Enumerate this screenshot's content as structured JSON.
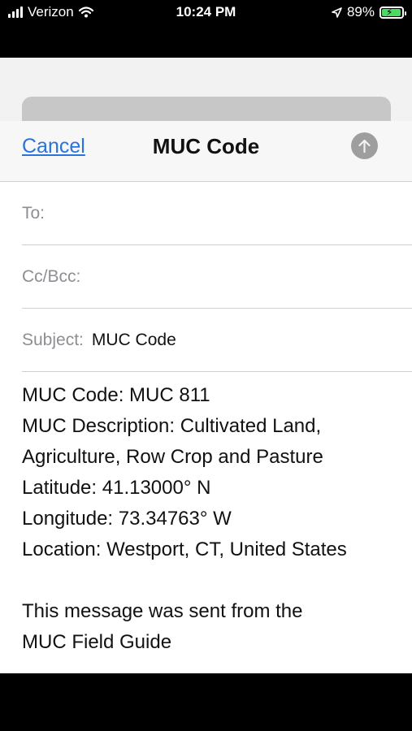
{
  "status_bar": {
    "carrier": "Verizon",
    "time": "10:24 PM",
    "battery_percent": "89%"
  },
  "nav": {
    "cancel_label": "Cancel",
    "title": "MUC Code",
    "send_icon": "arrow-up-icon"
  },
  "fields": {
    "to_label": "To:",
    "cc_label": "Cc/Bcc:",
    "subject_label": "Subject:",
    "subject_value": "MUC Code"
  },
  "body": {
    "line1": "MUC Code: MUC 811",
    "line2": "MUC Description: Cultivated Land,",
    "line3": "Agriculture, Row Crop and Pasture",
    "line4": "Latitude: 41.13000° N",
    "line5": "Longitude: 73.34763° W",
    "line6": "Location: Westport, CT, United States",
    "line7": "This message was sent from the",
    "line8": "MUC Field Guide"
  },
  "colors": {
    "accent": "#2a73d9",
    "battery": "#4cd964"
  }
}
